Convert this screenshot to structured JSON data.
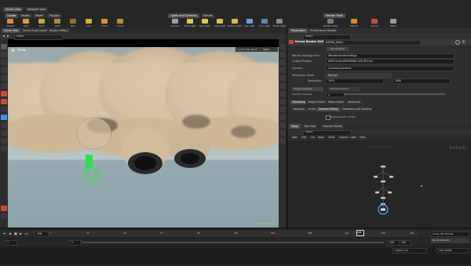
{
  "colors": {
    "accent": "#4a90d9",
    "highlight_orange": "#d98a2b",
    "green_gizmo": "#2ee04a",
    "sky": "#9fb8be",
    "cloud": "#d6c3a8"
  },
  "top_tabs": [
    "Scene View",
    "Network View"
  ],
  "shelf_left": {
    "tabs": [
      "Create",
      "Modify",
      "Model",
      "Polygon"
    ],
    "buttons": [
      "Sphere",
      "Tube",
      "Torus",
      "Grid",
      "Null",
      "Line",
      "Circle",
      "Curve"
    ]
  },
  "shelf_right": {
    "tabs": [
      "Lights and Cameras",
      "Render"
    ],
    "buttons": [
      "Camera",
      "Point Light",
      "Spot Light",
      "Area Light",
      "Distant Light",
      "Sky Light",
      "Env Light",
      "Portal Light"
    ]
  },
  "shelf_far_right": {
    "tabs": [
      "Render Tools"
    ],
    "buttons": [
      "Render View",
      "Mantra",
      "Karma",
      "Batch"
    ]
  },
  "viewport": {
    "pane_tabs": [
      "Scene View",
      "Scene Graph Layers",
      "Render Gallery"
    ],
    "path": "stage",
    "view_label": "View",
    "camera_label": "Karma CPU  Persp",
    "camera_sub": "cam1",
    "status_text": "Karma Render"
  },
  "params": {
    "pane_tabs": [
      "Parameters",
      "Performance Monitor"
    ],
    "path": "stage",
    "node_type": "Karma Render Settings",
    "node_name": "KARMA_Setup",
    "quick_setup": "Quick Setup",
    "fields": [
      {
        "label": "Render Settings Prim",
        "value": "/Render/rendersettings"
      },
      {
        "label": "Output Picture",
        "value": "$HIP/render/$HIPNAME.$OS.$F4.exr"
      },
      {
        "label": "Camera",
        "value": "/cameras/camera1"
      },
      {
        "label": "Resolution Mode",
        "value": "Manual"
      }
    ],
    "resolution_label": "Resolution",
    "resolution_x": "1920",
    "resolution_y": "1080",
    "engine_label": "Engine Settings",
    "engine_value": "CPU Parameters",
    "primary_samples_label": "Primary Samples",
    "primary_samples_value": "9",
    "tabs_row1": [
      "Rendering",
      "Image Output",
      "Deep Output",
      "Advanced"
    ],
    "tabs_row2": [
      "Sampling",
      "Limits",
      "Camera Effects",
      "Geometry and Shading"
    ],
    "checkbox_label": "Enable Depth of Field"
  },
  "network": {
    "pane_tabs": [
      "Stage",
      "Tree View",
      "Material Palette"
    ],
    "path": "stage",
    "menus": [
      "Add",
      "Edit",
      "Go",
      "View",
      "Tools",
      "Layout",
      "Labs",
      "Help"
    ],
    "context_label": "Solaris",
    "watermark": "Indie Edition"
  },
  "timeline": {
    "frame": "108",
    "tick_labels": [
      "1",
      "24",
      "48",
      "72",
      "96",
      "120",
      "144",
      "168",
      "192",
      "216",
      "240"
    ],
    "start_frame": "1",
    "end_frame": "240",
    "range_start": "1",
    "range_end": "240",
    "current_marker": "208",
    "keys_label": "0 keys, 0/0 channels",
    "key_all_label": "Key All Channels",
    "auto_update": "Auto Update",
    "filename": "/obj/Sunr_Wi..."
  }
}
